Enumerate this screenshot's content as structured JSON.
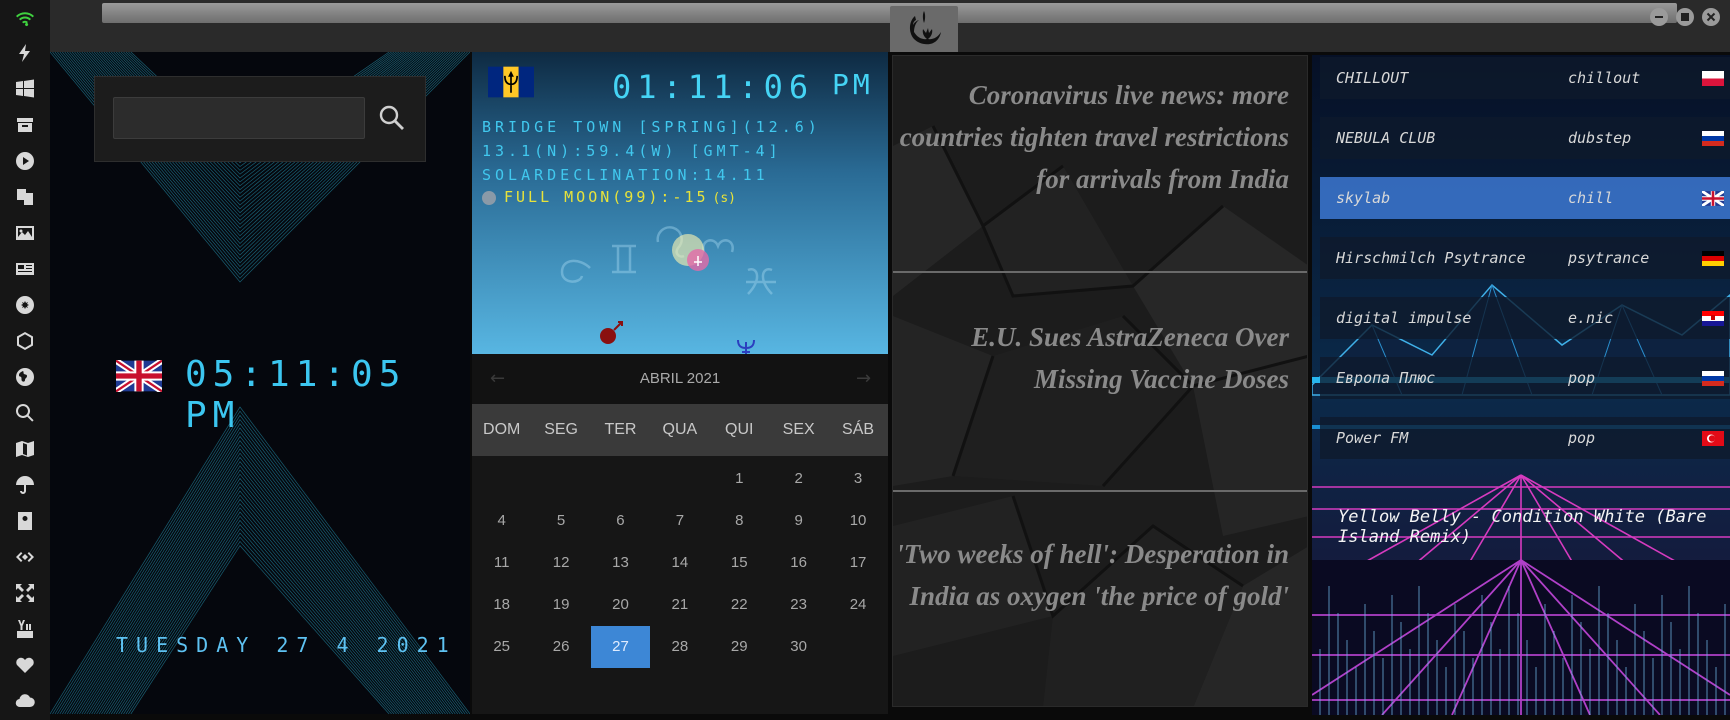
{
  "sidebar": {
    "icons": [
      "wifi-icon",
      "lightning-icon",
      "windows-icon",
      "archive-icon",
      "play-icon",
      "translate-icon",
      "image-icon",
      "news-icon",
      "settings-icon",
      "network-icon",
      "globe-icon",
      "search-icon",
      "map-icon",
      "umbrella-icon",
      "contacts-icon",
      "link-icon",
      "fullscreen-icon",
      "youtube-icon",
      "heart-icon",
      "cloud-icon"
    ]
  },
  "search": {
    "value": "",
    "placeholder": ""
  },
  "uk_clock": {
    "time": "05:11:05 PM",
    "date": "TUESDAY 27 4 2021"
  },
  "astro": {
    "time": "01:11:06",
    "ampm": "PM",
    "location": "BRIDGE TOWN [SPRING](12.6)",
    "coords": "13.1(N):59.4(W) [GMT-4]",
    "declination": "SOLARDECLINATION:14.11",
    "moon": "FULL MOON(99):-15",
    "moon_suffix": "(s)"
  },
  "calendar": {
    "month": "ABRIL 2021",
    "prev": "←",
    "next": "→",
    "days": [
      "DOM",
      "SEG",
      "TER",
      "QUA",
      "QUI",
      "SEX",
      "SÁB"
    ],
    "weeks": [
      [
        "",
        "",
        "",
        "",
        "1",
        "2",
        "3"
      ],
      [
        "4",
        "5",
        "6",
        "7",
        "8",
        "9",
        "10"
      ],
      [
        "11",
        "12",
        "13",
        "14",
        "15",
        "16",
        "17"
      ],
      [
        "18",
        "19",
        "20",
        "21",
        "22",
        "23",
        "24"
      ],
      [
        "25",
        "26",
        "27",
        "28",
        "29",
        "30",
        ""
      ]
    ],
    "today": "27"
  },
  "news": [
    "Coronavirus live news: more countries tighten travel restrictions for arrivals from India",
    "E.U. Sues AstraZeneca Over Missing Vaccine Doses",
    "'Two weeks of hell': Desperation in India as oxygen 'the price of gold'"
  ],
  "radio": {
    "stations": [
      {
        "name": "CHILLOUT",
        "genre": "chillout",
        "flag": "pl"
      },
      {
        "name": "NEBULA CLUB",
        "genre": "dubstep",
        "flag": "ru"
      },
      {
        "name": "skylab",
        "genre": "chill",
        "flag": "uk"
      },
      {
        "name": "Hirschmilch Psytrance",
        "genre": "psytrance",
        "flag": "de"
      },
      {
        "name": "digital impulse",
        "genre": "e.nic",
        "flag": "hr"
      },
      {
        "name": "Европа Плюс",
        "genre": "pop",
        "flag": "ru"
      },
      {
        "name": "Power FM",
        "genre": "pop",
        "flag": "tr"
      }
    ],
    "selected": "skylab",
    "now_playing": "Yellow Belly - Condition White (Bare Island Remix)"
  },
  "colors": {
    "digital_cyan": "#3cc6f0",
    "moon_yellow": "#e8e33a",
    "calendar_today": "#3d87d6",
    "station_selected": "#3c78d2",
    "wifi_green": "#3fd23f"
  }
}
